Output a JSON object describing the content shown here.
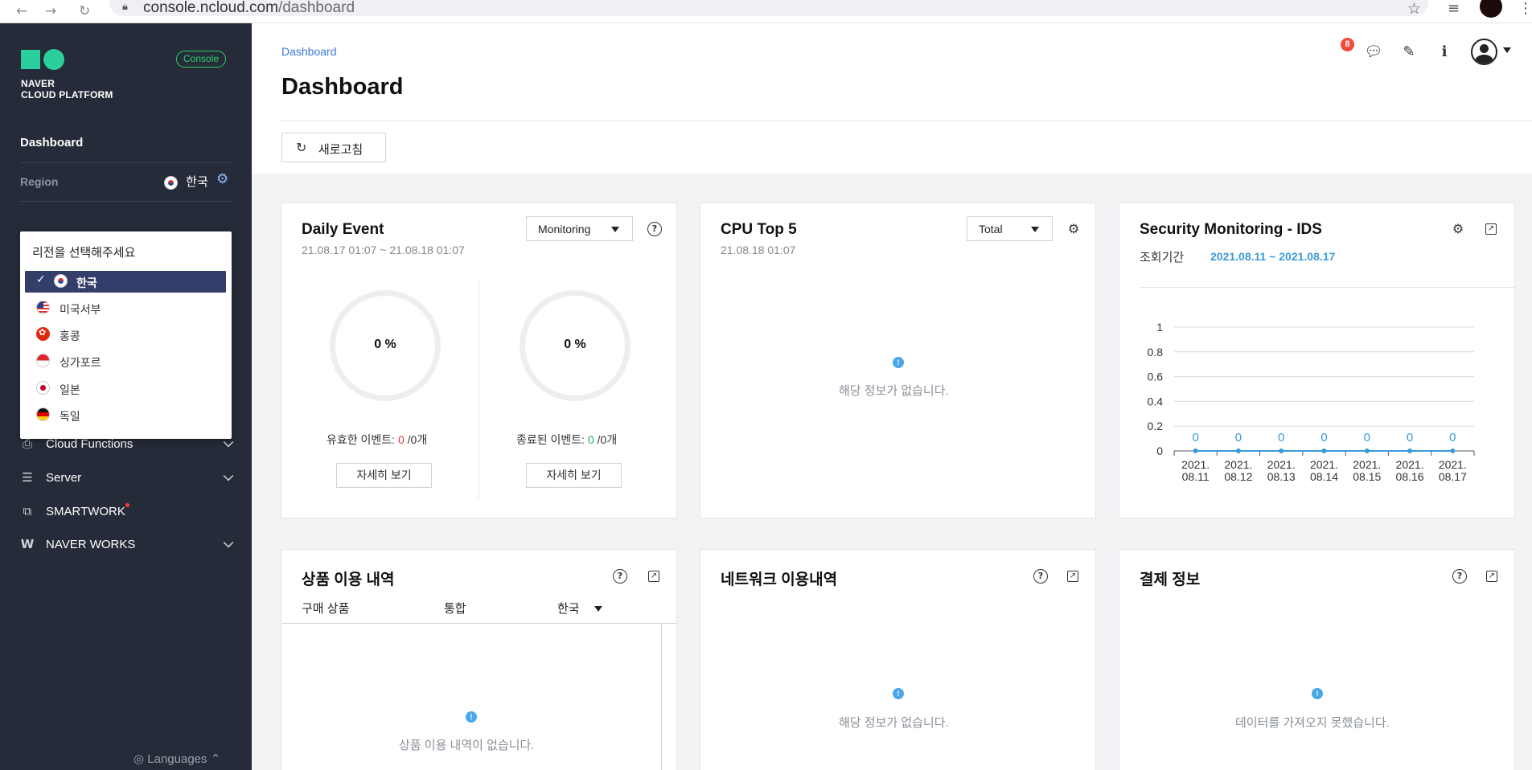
{
  "browser": {
    "url_host": "console.ncloud.com",
    "url_path": "/dashboard"
  },
  "sidebar": {
    "logo_line1": "NAVER",
    "logo_line2": "CLOUD PLATFORM",
    "console_badge": "Console",
    "dashboard_label": "Dashboard",
    "region_label": "Region",
    "region_value": "한국",
    "menu": [
      {
        "label": "Cloud Functions",
        "icon": "cloud-functions-icon"
      },
      {
        "label": "Server",
        "icon": "server-icon"
      },
      {
        "label": "SMARTWORK",
        "icon": "smartwork-icon"
      },
      {
        "label": "NAVER WORKS",
        "icon": "naver-works-icon"
      }
    ],
    "languages": "Languages"
  },
  "region_popup": {
    "title": "리전을 선택해주세요",
    "items": [
      {
        "label": "한국",
        "flag": "kr",
        "selected": true
      },
      {
        "label": "미국서부",
        "flag": "us"
      },
      {
        "label": "홍콩",
        "flag": "hk"
      },
      {
        "label": "싱가포르",
        "flag": "sg"
      },
      {
        "label": "일본",
        "flag": "jp"
      },
      {
        "label": "독일",
        "flag": "de"
      }
    ]
  },
  "header": {
    "breadcrumb": "Dashboard",
    "title": "Dashboard",
    "refresh_label": "새로고침",
    "notification_count": "8"
  },
  "daily_event": {
    "title": "Daily Event",
    "period": "21.08.17 01:07 ~ 21.08.18 01:07",
    "select_value": "Monitoring",
    "left_value": "0 %",
    "right_value": "0 %",
    "valid_label": "유효한 이벤트: ",
    "valid_count": "0",
    "valid_total": " /0개",
    "ended_label": "종료된 이벤트: ",
    "ended_count": "0",
    "ended_total": " /0개",
    "detail_label": "자세히 보기"
  },
  "cpu_top5": {
    "title": "CPU Top 5",
    "time": "21.08.18 01:07",
    "select_value": "Total",
    "empty": "해당 정보가 없습니다."
  },
  "security": {
    "title": "Security Monitoring - IDS",
    "period_label": "조회기간",
    "period_value": "2021.08.11 ~ 2021.08.17"
  },
  "chart_data": {
    "type": "line",
    "x": [
      "2021.\n08.11",
      "2021.\n08.12",
      "2021.\n08.13",
      "2021.\n08.14",
      "2021.\n08.15",
      "2021.\n08.16",
      "2021.\n08.17"
    ],
    "values": [
      0,
      0,
      0,
      0,
      0,
      0,
      0
    ],
    "yticks": [
      "0",
      "0.2",
      "0.4",
      "0.6",
      "0.8",
      "1"
    ],
    "ylim": [
      0,
      1
    ],
    "grid": true,
    "color": "#3a9ad9"
  },
  "product_usage": {
    "title": "상품 이용 내역",
    "col1": "구매 상품",
    "col2": "통합",
    "col3": "한국",
    "empty": "상품 이용 내역이 없습니다."
  },
  "network_usage": {
    "title": "네트워크 이용내역",
    "empty": "해당 정보가 없습니다."
  },
  "payment": {
    "title": "결제 정보",
    "empty": "데이터를 가져오지 못했습니다."
  }
}
